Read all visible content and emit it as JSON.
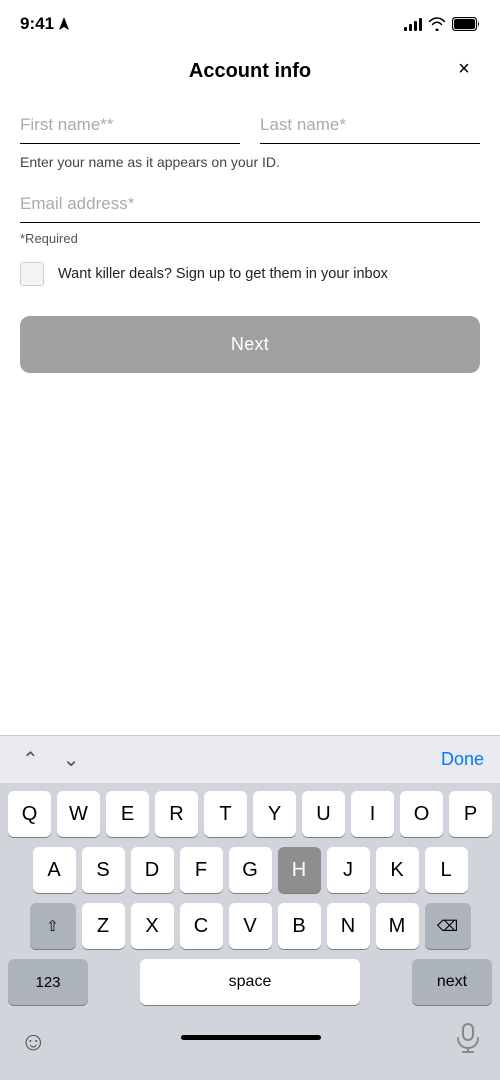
{
  "statusBar": {
    "time": "9:41",
    "arrowIcon": "navigation-arrow"
  },
  "header": {
    "title": "Account info",
    "closeLabel": "×"
  },
  "form": {
    "firstNamePlaceholder": "First name**",
    "lastNamePlaceholder": "Last name*",
    "helperText": "Enter your name as it appears on your ID.",
    "emailPlaceholder": "Email address*",
    "requiredText": "*Required",
    "checkboxLabel": "Want killer deals? Sign up to get them in your inbox",
    "nextButtonLabel": "Next"
  },
  "keyboard": {
    "doneLabel": "Done",
    "numbersLabel": "123",
    "spaceLabel": "space",
    "nextLabel": "next",
    "row1": [
      "Q",
      "W",
      "E",
      "R",
      "T",
      "Y",
      "U",
      "I",
      "O",
      "P"
    ],
    "row2": [
      "A",
      "S",
      "D",
      "F",
      "G",
      "H",
      "J",
      "K",
      "L"
    ],
    "row3": [
      "Z",
      "X",
      "C",
      "V",
      "B",
      "N",
      "M"
    ],
    "highlightedKey": "H"
  }
}
